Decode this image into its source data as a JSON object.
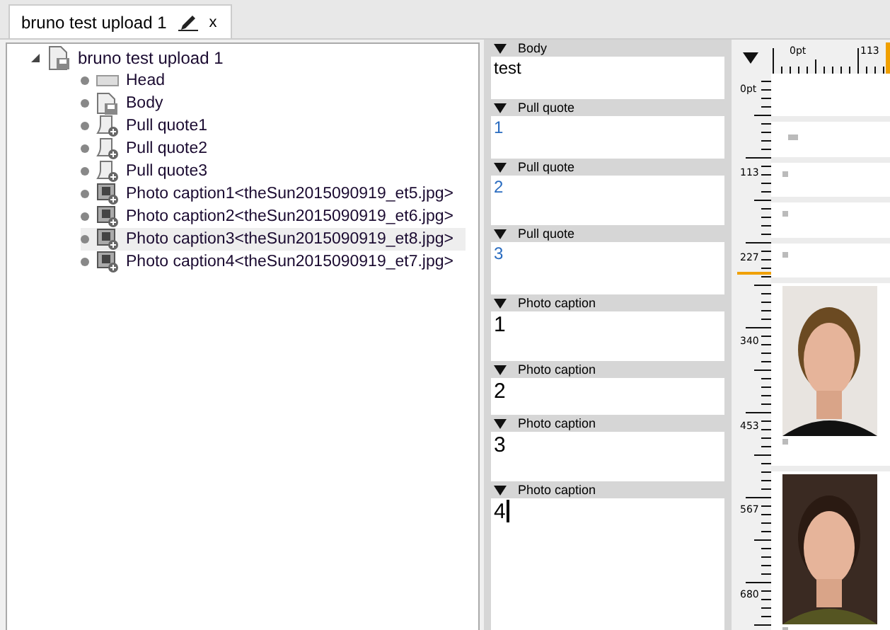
{
  "tab": {
    "title": "bruno test upload 1",
    "close": "x",
    "selected": true
  },
  "tree": {
    "root": {
      "label": "bruno test upload 1",
      "expanded": true,
      "children": [
        {
          "label": "Head",
          "kind": "head",
          "selected": false
        },
        {
          "label": "Body",
          "kind": "body",
          "selected": false
        },
        {
          "label": "Pull quote1",
          "kind": "quote",
          "selected": false
        },
        {
          "label": "Pull quote2",
          "kind": "quote",
          "selected": false
        },
        {
          "label": "Pull quote3",
          "kind": "quote",
          "selected": false
        },
        {
          "label": "Photo caption1<theSun2015090919_et5.jpg>",
          "selected": false
        },
        {
          "label": "Photo caption2<theSun2015090919_et6.jpg>",
          "selected": false
        },
        {
          "label": "Photo caption3<theSun2015090919_et8.jpg>",
          "selected": true
        },
        {
          "label": "Photo caption4<theSun2015090919_et7.jpg>",
          "selected": false
        }
      ]
    }
  },
  "fields": [
    {
      "title": "Body",
      "value": "test",
      "focused": false
    },
    {
      "title": "Pull quote",
      "value": "1",
      "focused": false
    },
    {
      "title": "Pull quote",
      "value": "2",
      "focused": false
    },
    {
      "title": "Pull quote",
      "value": "3",
      "focused": false
    },
    {
      "title": "Photo caption",
      "value": "1",
      "focused": false
    },
    {
      "title": "Photo caption",
      "value": "2",
      "focused": false
    },
    {
      "title": "Photo caption",
      "value": "3",
      "focused": false
    },
    {
      "title": "Photo caption",
      "value": "4",
      "focused": true
    }
  ],
  "preview": {
    "top_ruler": [
      "0pt",
      "113"
    ],
    "left_ruler": [
      "0pt",
      "113",
      "227",
      "340",
      "453",
      "567",
      "680"
    ],
    "blocks": [
      {
        "kind": "text"
      },
      {
        "kind": "text"
      },
      {
        "kind": "text"
      },
      {
        "kind": "text"
      },
      {
        "kind": "text"
      },
      {
        "kind": "picture"
      },
      {
        "kind": "picture"
      }
    ]
  }
}
